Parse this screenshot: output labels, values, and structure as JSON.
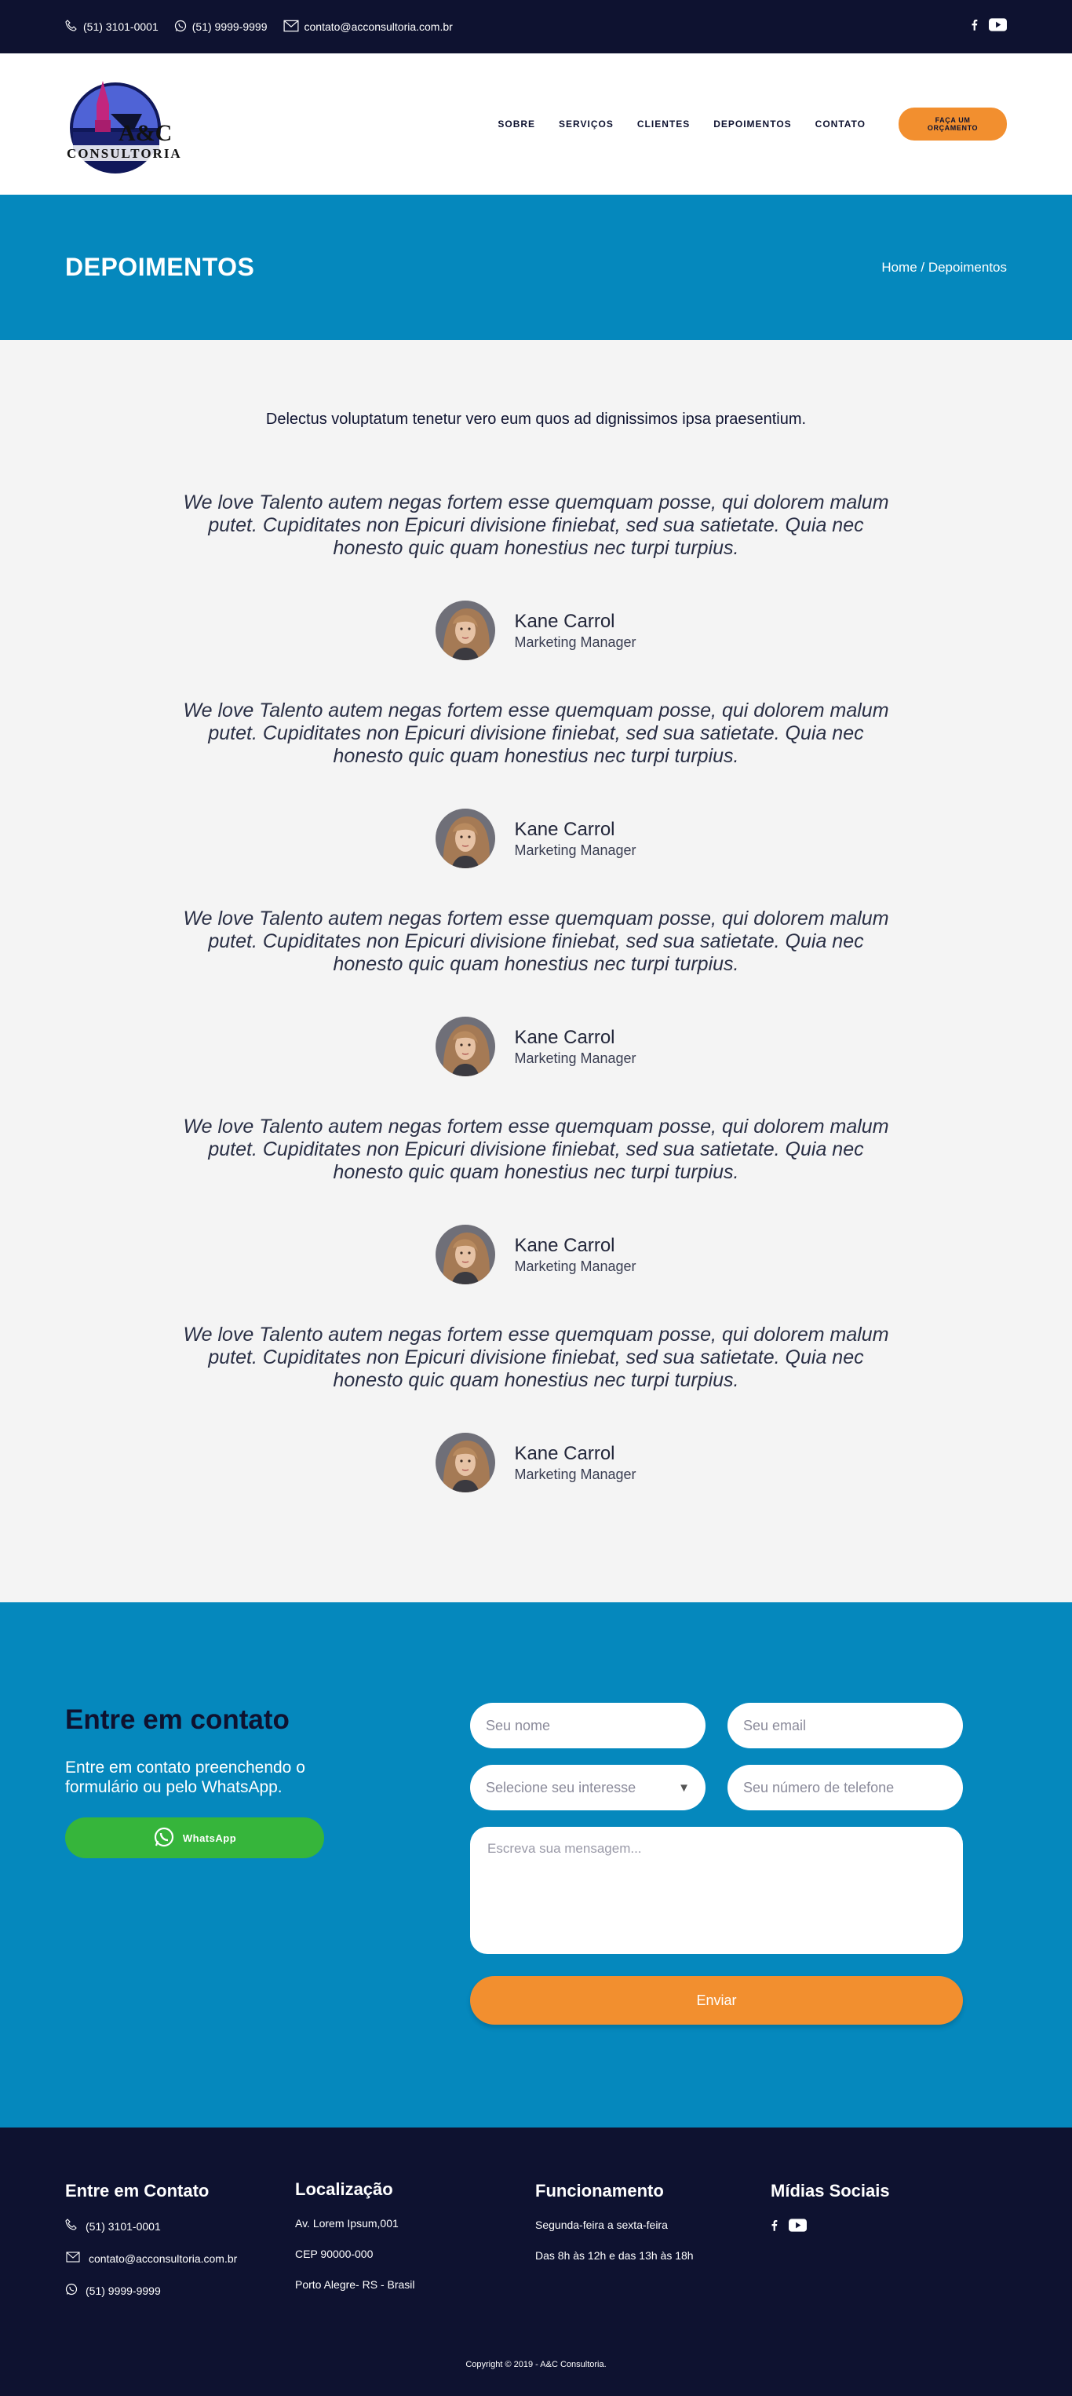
{
  "topbar": {
    "phone": "(51) 3101-0001",
    "whatsapp": "(51) 9999-9999",
    "email": "contato@acconsultoria.com.br",
    "social_icons": [
      "facebook-icon",
      "youtube-icon"
    ]
  },
  "header": {
    "logo_text": "A&C",
    "logo_subtext": "CONSULTORIA",
    "nav": [
      "SOBRE",
      "SERVIÇOS",
      "CLIENTES",
      "DEPOIMENTOS",
      "CONTATO"
    ],
    "cta": "FAÇA UM ORÇAMENTO"
  },
  "banner": {
    "title": "DEPOIMENTOS",
    "breadcrumb": "Home / Depoimentos"
  },
  "testimonials": {
    "intro": "Delectus voluptatum tenetur vero eum quos ad dignissimos ipsa praesentium.",
    "items": [
      {
        "quote": "We love Talento autem negas fortem esse quemquam posse, qui dolorem malum putet. Cupiditates non Epicuri divisione finiebat, sed sua satietate. Quia nec honesto quic quam honestius nec turpi turpius.",
        "name": "Kane Carrol",
        "role": "Marketing Manager"
      },
      {
        "quote": "We love Talento autem negas fortem esse quemquam posse, qui dolorem malum putet. Cupiditates non Epicuri divisione finiebat, sed sua satietate. Quia nec honesto quic quam honestius nec turpi turpius.",
        "name": "Kane Carrol",
        "role": "Marketing Manager"
      },
      {
        "quote": "We love Talento autem negas fortem esse quemquam posse, qui dolorem malum putet. Cupiditates non Epicuri divisione finiebat, sed sua satietate. Quia nec honesto quic quam honestius nec turpi turpius.",
        "name": "Kane Carrol",
        "role": "Marketing Manager"
      },
      {
        "quote": "We love Talento autem negas fortem esse quemquam posse, qui dolorem malum putet. Cupiditates non Epicuri divisione finiebat, sed sua satietate. Quia nec honesto quic quam honestius nec turpi turpius.",
        "name": "Kane Carrol",
        "role": "Marketing Manager"
      },
      {
        "quote": "We love Talento autem negas fortem esse quemquam posse, qui dolorem malum putet. Cupiditates non Epicuri divisione finiebat, sed sua satietate. Quia nec honesto quic quam honestius nec turpi turpius.",
        "name": "Kane Carrol",
        "role": "Marketing Manager"
      }
    ]
  },
  "contact": {
    "title": "Entre em contato",
    "text": "Entre em contato preenchendo o formulário ou pelo WhatsApp.",
    "whatsapp_button": "WhatsApp",
    "name_placeholder": "Seu nome",
    "email_placeholder": "Seu email",
    "interest_select": "Selecione seu interesse",
    "phone_placeholder": "Seu número de telefone",
    "message_placeholder": "Escreva sua mensagem...",
    "submit": "Enviar"
  },
  "footer": {
    "contact_title": "Entre em Contato",
    "phone": "(51) 3101-0001",
    "email": "contato@acconsultoria.com.br",
    "whatsapp": "(51) 9999-9999",
    "location_title": "Localização",
    "address": "Av. Lorem Ipsum,001",
    "cep": "CEP 90000-000",
    "city": "Porto Alegre- RS - Brasil",
    "hours_title": "Funcionamento",
    "days": "Segunda-feira a sexta-feira",
    "hours": "Das 8h às 12h e das 13h às 18h",
    "social_title": "Mídias Sociais",
    "copyright": "Copyright © 2019 - A&C Consultoria."
  },
  "colors": {
    "navy": "#0e1230",
    "blue": "#0588bd",
    "orange": "#f28f2f",
    "green": "#36b53b",
    "light": "#f4f4f4"
  }
}
